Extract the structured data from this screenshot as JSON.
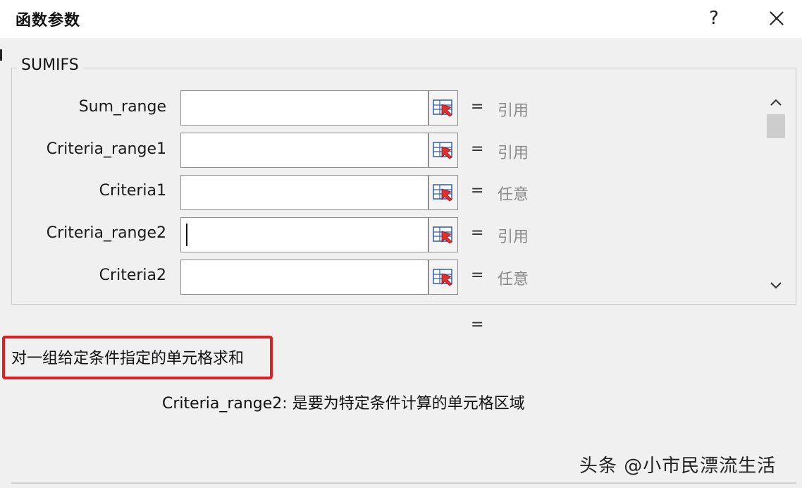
{
  "window": {
    "title": "函数参数",
    "help_label": "?"
  },
  "function_group": {
    "name": "SUMIFS",
    "args": [
      {
        "label": "Sum_range",
        "value": "",
        "equals": "=",
        "result": "引用"
      },
      {
        "label": "Criteria_range1",
        "value": "",
        "equals": "=",
        "result": "引用"
      },
      {
        "label": "Criteria1",
        "value": "",
        "equals": "=",
        "result": "任意"
      },
      {
        "label": "Criteria_range2",
        "value": "",
        "equals": "=",
        "result": "引用"
      },
      {
        "label": "Criteria2",
        "value": "",
        "equals": "=",
        "result": "任意"
      }
    ]
  },
  "formula_result": {
    "equals": "="
  },
  "description": "对一组给定条件指定的单元格求和",
  "param_help": "Criteria_range2:  是要为特定条件计算的单元格区域",
  "watermark": "头条 @小市民漂流生活",
  "colors": {
    "highlight_border": "#e02020",
    "background": "#f0f0f0"
  },
  "icons": [
    "close-icon",
    "range-select-icon",
    "chevron-up-icon",
    "chevron-down-icon"
  ]
}
